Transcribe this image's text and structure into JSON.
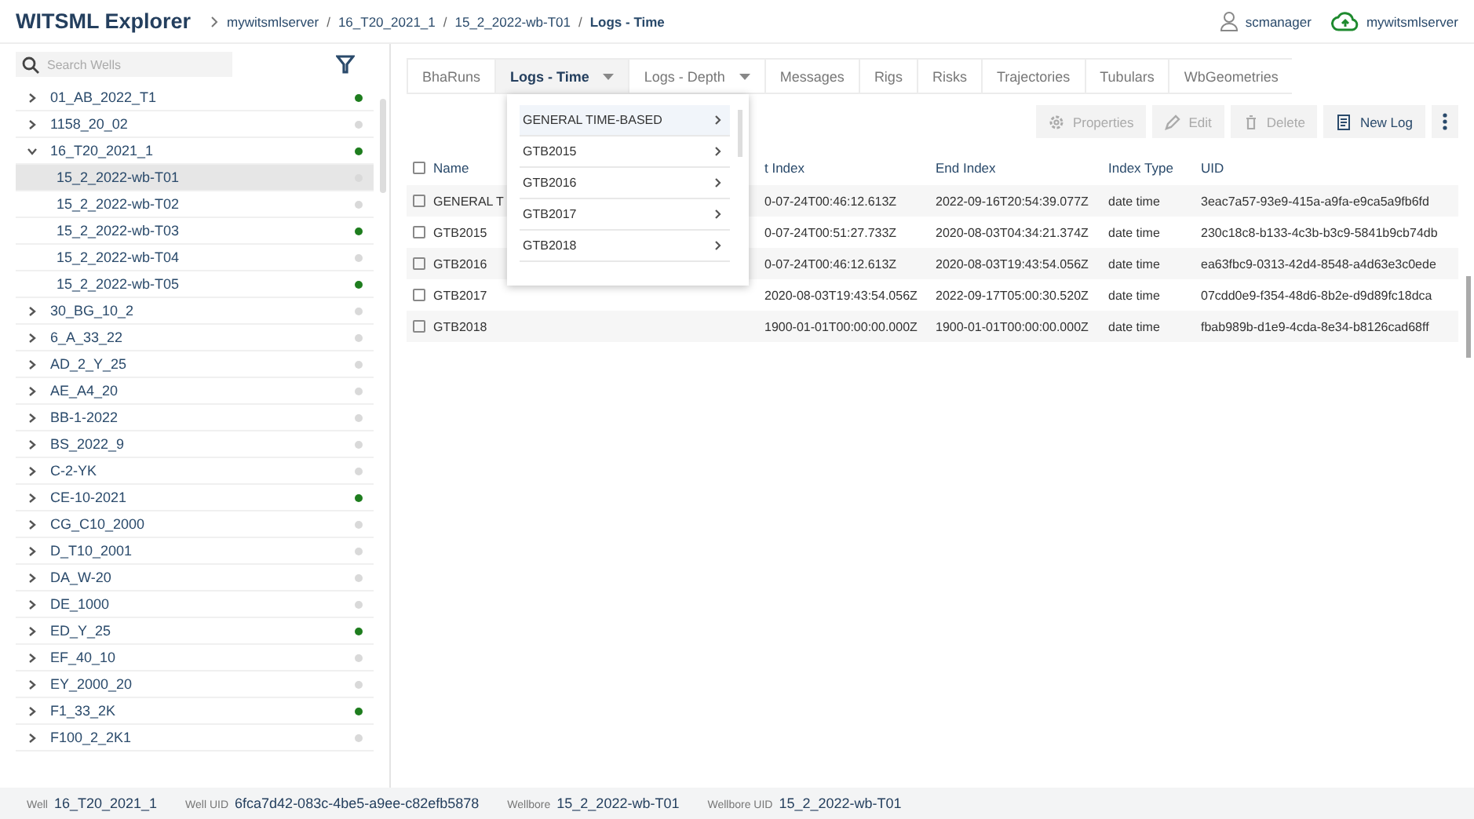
{
  "header": {
    "title": "WITSML Explorer",
    "separator": "/",
    "breadcrumb": [
      {
        "label": "mywitsmlserver",
        "current": false
      },
      {
        "label": "16_T20_2021_1",
        "current": false
      },
      {
        "label": "15_2_2022-wb-T01",
        "current": false
      },
      {
        "label": "Logs - Time",
        "current": true
      }
    ],
    "user": "scmanager",
    "server": "mywitsmlserver"
  },
  "sidebar": {
    "search": {
      "placeholder": "Search Wells"
    },
    "wells": [
      {
        "label": "01_AB_2022_T1",
        "expanded": false,
        "selected": false,
        "color": "#1e7d1e"
      },
      {
        "label": "1158_20_02",
        "expanded": false,
        "selected": false,
        "color": "#d9d9d9"
      },
      {
        "label": "16_T20_2021_1",
        "expanded": true,
        "selected": false,
        "color": "#1e7d1e",
        "children": [
          {
            "label": "15_2_2022-wb-T01",
            "selected": true,
            "color": "#d9d9d9"
          },
          {
            "label": "15_2_2022-wb-T02",
            "selected": false,
            "color": "#d9d9d9"
          },
          {
            "label": "15_2_2022-wb-T03",
            "selected": false,
            "color": "#1e7d1e"
          },
          {
            "label": "15_2_2022-wb-T04",
            "selected": false,
            "color": "#d9d9d9"
          },
          {
            "label": "15_2_2022-wb-T05",
            "selected": false,
            "color": "#1e7d1e"
          }
        ]
      },
      {
        "label": "30_BG_10_2",
        "expanded": false,
        "selected": false,
        "color": "#d9d9d9"
      },
      {
        "label": "6_A_33_22",
        "expanded": false,
        "selected": false,
        "color": "#d9d9d9"
      },
      {
        "label": "AD_2_Y_25",
        "expanded": false,
        "selected": false,
        "color": "#d9d9d9"
      },
      {
        "label": "AE_A4_20",
        "expanded": false,
        "selected": false,
        "color": "#d9d9d9"
      },
      {
        "label": "BB-1-2022",
        "expanded": false,
        "selected": false,
        "color": "#d9d9d9"
      },
      {
        "label": "BS_2022_9",
        "expanded": false,
        "selected": false,
        "color": "#d9d9d9"
      },
      {
        "label": "C-2-YK",
        "expanded": false,
        "selected": false,
        "color": "#d9d9d9"
      },
      {
        "label": "CE-10-2021",
        "expanded": false,
        "selected": false,
        "color": "#1e7d1e"
      },
      {
        "label": "CG_C10_2000",
        "expanded": false,
        "selected": false,
        "color": "#d9d9d9"
      },
      {
        "label": "D_T10_2001",
        "expanded": false,
        "selected": false,
        "color": "#d9d9d9"
      },
      {
        "label": "DA_W-20",
        "expanded": false,
        "selected": false,
        "color": "#d9d9d9"
      },
      {
        "label": "DE_1000",
        "expanded": false,
        "selected": false,
        "color": "#d9d9d9"
      },
      {
        "label": "ED_Y_25",
        "expanded": false,
        "selected": false,
        "color": "#1e7d1e"
      },
      {
        "label": "EF_40_10",
        "expanded": false,
        "selected": false,
        "color": "#d9d9d9"
      },
      {
        "label": "EY_2000_20",
        "expanded": false,
        "selected": false,
        "color": "#d9d9d9"
      },
      {
        "label": "F1_33_2K",
        "expanded": false,
        "selected": false,
        "color": "#1e7d1e"
      },
      {
        "label": "F100_2_2K1",
        "expanded": false,
        "selected": false,
        "color": "#d9d9d9"
      }
    ]
  },
  "tabs": [
    {
      "label": "BhaRuns",
      "selected": false,
      "dropdown": false
    },
    {
      "label": "Logs - Time",
      "selected": true,
      "dropdown": true
    },
    {
      "label": "Logs - Depth",
      "selected": false,
      "dropdown": true
    },
    {
      "label": "Messages",
      "selected": false,
      "dropdown": false
    },
    {
      "label": "Rigs",
      "selected": false,
      "dropdown": false
    },
    {
      "label": "Risks",
      "selected": false,
      "dropdown": false
    },
    {
      "label": "Trajectories",
      "selected": false,
      "dropdown": false
    },
    {
      "label": "Tubulars",
      "selected": false,
      "dropdown": false
    },
    {
      "label": "WbGeometries",
      "selected": false,
      "dropdown": false
    }
  ],
  "tab_menu": [
    {
      "label": "GENERAL TIME-BASED",
      "selected": true
    },
    {
      "label": "GTB2015",
      "selected": false
    },
    {
      "label": "GTB2016",
      "selected": false
    },
    {
      "label": "GTB2017",
      "selected": false
    },
    {
      "label": "GTB2018",
      "selected": false
    }
  ],
  "toolbar": [
    {
      "kind": "properties",
      "label": "Properties",
      "disabled": true
    },
    {
      "kind": "edit",
      "label": "Edit",
      "disabled": true
    },
    {
      "kind": "delete",
      "label": "Delete",
      "disabled": true
    },
    {
      "kind": "new",
      "label": "New Log",
      "disabled": false
    },
    {
      "kind": "more"
    }
  ],
  "table": {
    "columns": [
      "Name",
      "t Index",
      "End Index",
      "Index Type",
      "UID"
    ],
    "header_checked": false,
    "rows": [
      {
        "checked": false,
        "cells": [
          "GENERAL T",
          "0-07-24T00:46:12.613Z",
          "2022-09-16T20:54:39.077Z",
          "date time",
          "3eac7a57-93e9-415a-a9fa-e9ca5a9fb6fd"
        ]
      },
      {
        "checked": false,
        "cells": [
          "GTB2015",
          "0-07-24T00:51:27.733Z",
          "2020-08-03T04:34:21.374Z",
          "date time",
          "230c18c8-b133-4c3b-b3c9-5841b9cb74db"
        ]
      },
      {
        "checked": false,
        "cells": [
          "GTB2016",
          "0-07-24T00:46:12.613Z",
          "2020-08-03T19:43:54.056Z",
          "date time",
          "ea63fbc9-0313-42d4-8548-a4d63e3c0ede"
        ]
      },
      {
        "checked": false,
        "cells": [
          "GTB2017",
          "2020-08-03T19:43:54.056Z",
          "2022-09-17T05:00:30.520Z",
          "date time",
          "07cdd0e9-f354-48d6-8b2e-d9d89fc18dca"
        ]
      },
      {
        "checked": false,
        "cells": [
          "GTB2018",
          "1900-01-01T00:00:00.000Z",
          "1900-01-01T00:00:00.000Z",
          "date time",
          "fbab989b-d1e9-4cda-8e34-b8126cad68ff"
        ]
      }
    ]
  },
  "status_bar": [
    {
      "label": "Well",
      "value": "16_T20_2021_1"
    },
    {
      "label": "Well UID",
      "value": "6fca7d42-083c-4be5-a9ee-c82efb5878"
    },
    {
      "label": "Wellbore",
      "value": "15_2_2022-wb-T01"
    },
    {
      "label": "Wellbore UID",
      "value": "15_2_2022-wb-T01"
    }
  ]
}
